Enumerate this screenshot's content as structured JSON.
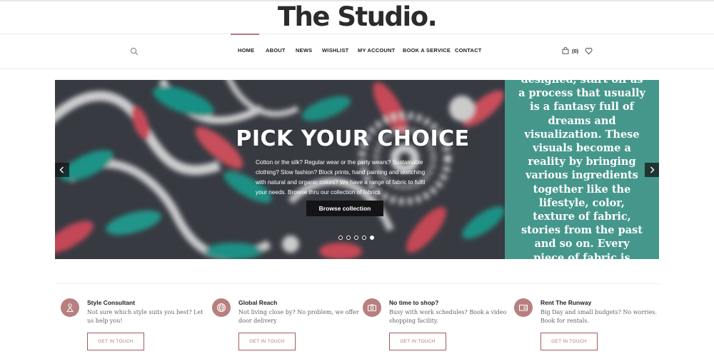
{
  "logo": "The Studio.",
  "nav": {
    "items": [
      "HOME",
      "ABOUT",
      "NEWS",
      "WISHLIST",
      "MY ACCOUNT",
      "BOOK A SERVICE",
      "CONTACT"
    ],
    "cart_count": "(0)",
    "icons": {
      "search": "search-icon",
      "cart": "shopping-bag-icon",
      "wishlist": "heart-icon"
    },
    "accent_color": "#b5797b"
  },
  "slider": {
    "title": "PICK YOUR CHOICE",
    "description": "Cotton or the silk? Regular wear or the party wears? Sustainable clothing? Slow fashion? Block prints, hand painting and sketching with natural and organic colors? We have a range of fabric to fulfil your needs. Browse thru our collection of fabrics.",
    "button": "Browse collection",
    "panel_lines": [
      "designed, start off as",
      "a process that usually",
      "is a fantasy full of",
      "dreams and",
      "visualization. These",
      "visuals become a",
      "reality by bringing",
      "various ingredients",
      "together like the",
      "lifestyle, color,",
      "texture of fabric,",
      "stories from the past",
      "and so on. Every",
      "piece of fabric is"
    ],
    "dot_count": 5,
    "active_dot": 5,
    "panel_color": "#4ab2a0"
  },
  "features": [
    {
      "title": "Style Consultant",
      "desc": "Not sure which style suits you best? Let us help you!",
      "button": "GET IN TOUCH",
      "icon": "person-icon"
    },
    {
      "title": "Global Reach",
      "desc": "Not living close by? No problem, we offer door delivery",
      "button": "GET IN TOUCH",
      "icon": "globe-icon"
    },
    {
      "title": "No time to shop?",
      "desc": "Busy with work schedules? Book a video shopping facility.",
      "button": "GET IN TOUCH",
      "icon": "camera-icon"
    },
    {
      "title": "Rent The Runway",
      "desc": "Big Day and small budgets? No worries. Book for rentals.",
      "button": "GET IN TOUCH",
      "icon": "wallet-icon"
    }
  ],
  "feature_icon_color": "#b87f7f"
}
